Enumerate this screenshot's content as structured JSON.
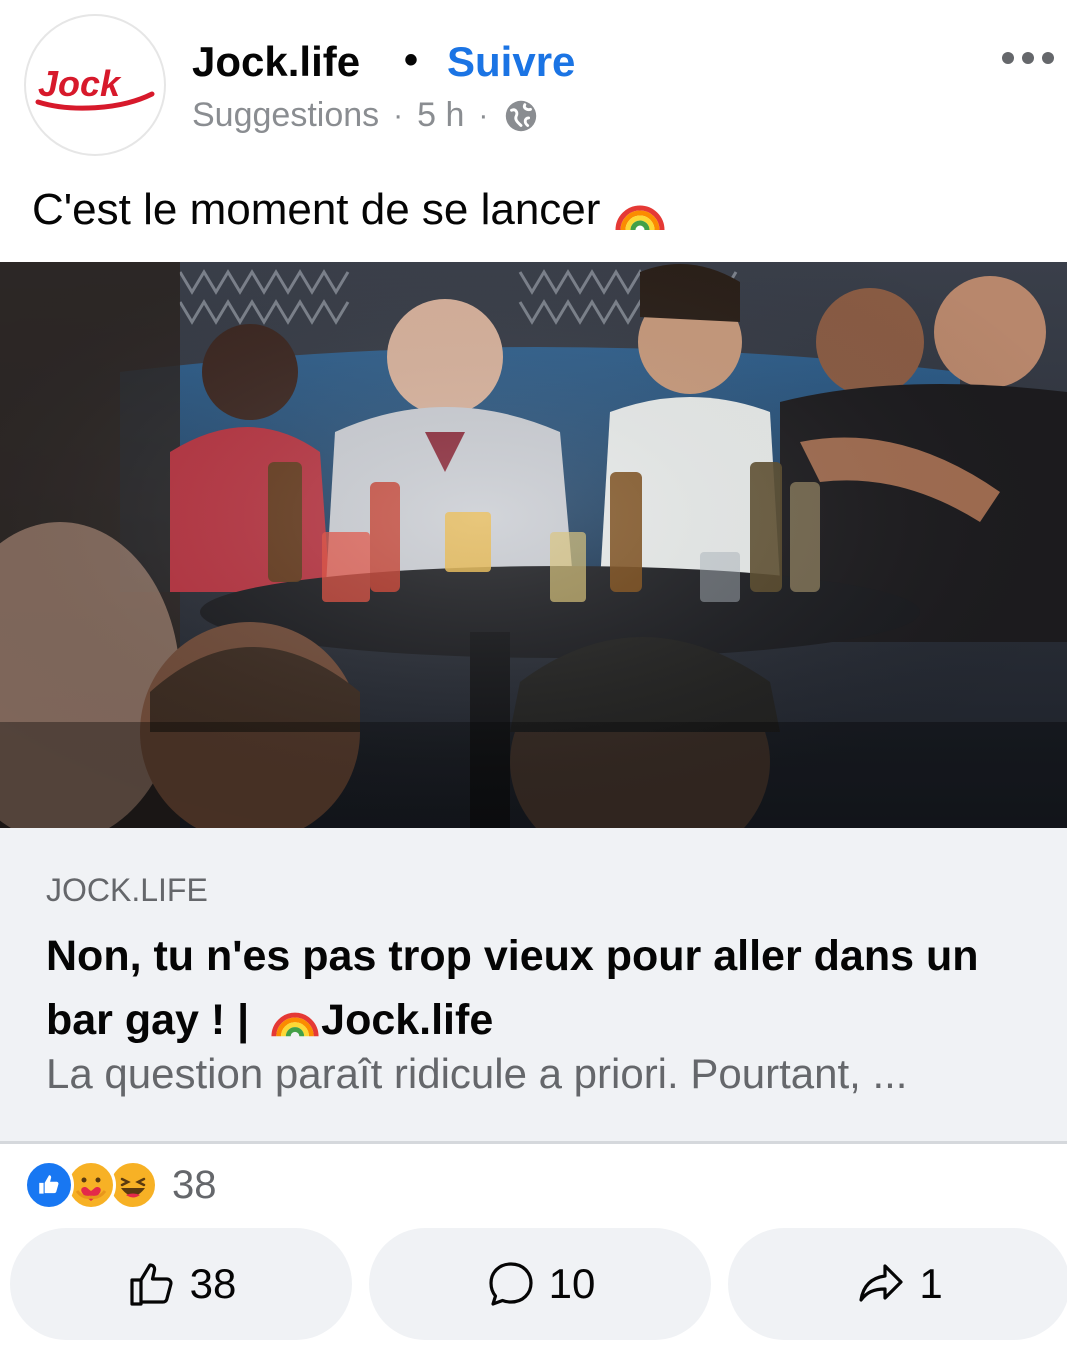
{
  "header": {
    "page_name": "Jock.life",
    "dot": "•",
    "follow_label": "Suivre",
    "meta_source": "Suggestions",
    "meta_sep": "·",
    "meta_time": "5 h",
    "avatar_icon": "jock-logo",
    "privacy_icon": "globe-icon",
    "more_icon": "more-dots-icon",
    "brand_color": "#d7192b",
    "follow_color": "#1b74e4"
  },
  "caption": {
    "text": "C'est le moment de se lancer",
    "emoji_icon": "rainbow-icon"
  },
  "photo": {
    "description_icon": "bar-photo"
  },
  "link": {
    "domain": "JOCK.LIFE",
    "title_part1": "Non, tu n'es pas trop vieux pour aller dans un bar gay ! |",
    "title_part2": "Jock.life",
    "description": "La question paraît ridicule a priori. Pourtant, ..."
  },
  "reactions": {
    "icons": [
      "like-icon",
      "care-icon",
      "haha-icon"
    ],
    "count": "38"
  },
  "actions": {
    "like_count": "38",
    "comment_count": "10",
    "share_count": "1"
  }
}
